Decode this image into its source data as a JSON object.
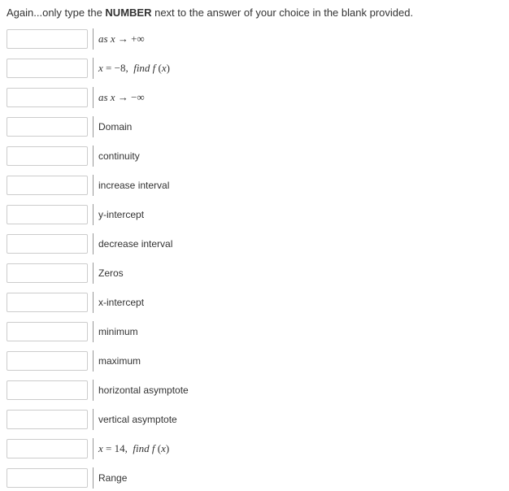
{
  "instruction": {
    "prefix": "Again...only type the ",
    "bold": "NUMBER",
    "suffix": " next to the answer of your choice in the blank provided."
  },
  "rows": [
    {
      "type": "math",
      "html": "as <span class='var'>x</span> <span class='op'>→ +∞</span>"
    },
    {
      "type": "math",
      "html": "<span class='var'>x</span> <span class='op'>= −8,</span> &nbsp;<span class='var'>find f</span> <span class='op'>(</span><span class='var'>x</span><span class='op'>)</span>"
    },
    {
      "type": "math",
      "html": "<span class='var'>as x</span> <span class='op'>→ −∞</span>"
    },
    {
      "type": "text",
      "text": "Domain"
    },
    {
      "type": "text",
      "text": "continuity"
    },
    {
      "type": "text",
      "text": "increase interval"
    },
    {
      "type": "text",
      "text": "y-intercept"
    },
    {
      "type": "text",
      "text": "decrease interval"
    },
    {
      "type": "text",
      "text": "Zeros"
    },
    {
      "type": "text",
      "text": "x-intercept"
    },
    {
      "type": "text",
      "text": "minimum"
    },
    {
      "type": "text",
      "text": "maximum"
    },
    {
      "type": "text",
      "text": "horizontal asymptote"
    },
    {
      "type": "text",
      "text": "vertical asymptote"
    },
    {
      "type": "math",
      "html": "<span class='var'>x</span> <span class='op'>= 14,</span> &nbsp;<span class='var'>find f</span> <span class='op'>(</span><span class='var'>x</span><span class='op'>)</span>"
    },
    {
      "type": "text",
      "text": "Range"
    }
  ]
}
